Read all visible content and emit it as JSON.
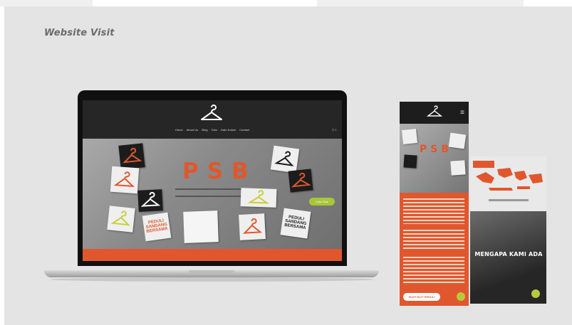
{
  "page": {
    "title": "Website Visit"
  },
  "laptop_site": {
    "nav_items": [
      "Home",
      "About Us",
      "Blog",
      "Toko",
      "Dato Kolam",
      "Contact"
    ],
    "social": "ⓔ f",
    "hero_title": "PSB",
    "notes": [
      {
        "text": "PEDULI SANDANG BERSAMA"
      },
      {
        "text": "PEDULI SANDANG BERSAMA"
      }
    ],
    "cta_label": "Lets Chat"
  },
  "phone_site": {
    "hero_title": "PSB",
    "button_label": "IKUTI IKUT PEDULI"
  },
  "phone2_site": {
    "photo_title": "MENGAPA KAMI ADA"
  },
  "colors": {
    "brand_orange": "#e0572e",
    "accent_green": "#a8c63a",
    "dark": "#1d1d1d",
    "background": "#e4e4e4"
  }
}
